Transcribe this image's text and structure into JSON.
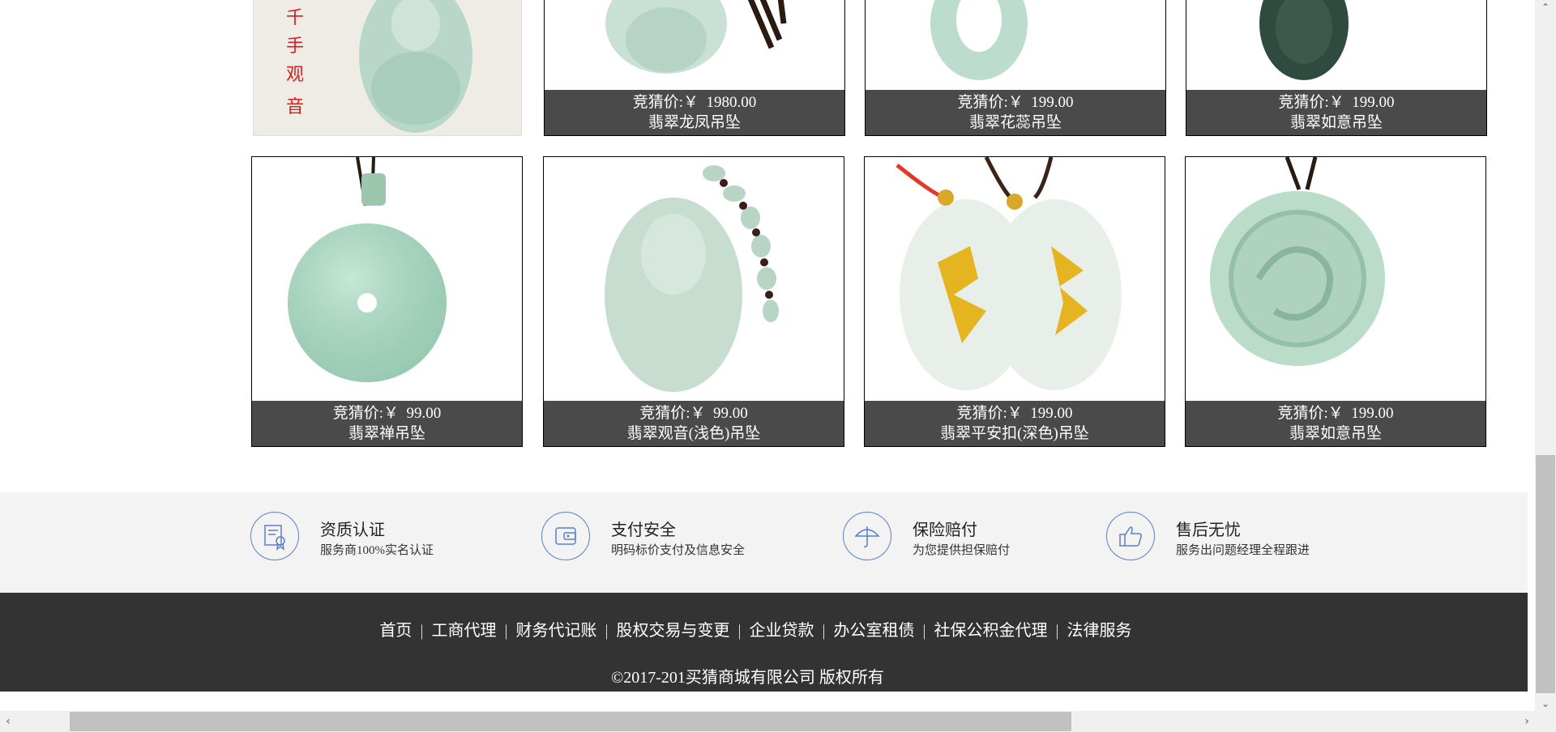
{
  "products": [
    {
      "price_label": "竞猜价:",
      "currency": "￥",
      "price": "1980.00",
      "name": "翡翠龙凤吊坠"
    },
    {
      "price_label": "竞猜价:",
      "currency": "￥",
      "price": "199.00",
      "name": "翡翠花蕊吊坠"
    },
    {
      "price_label": "竞猜价:",
      "currency": "￥",
      "price": "199.00",
      "name": "翡翠如意吊坠"
    },
    {
      "price_label": "竞猜价:",
      "currency": "￥",
      "price": "99.00",
      "name": "翡翠禅吊坠"
    },
    {
      "price_label": "竞猜价:",
      "currency": "￥",
      "price": "99.00",
      "name": "翡翠观音(浅色)吊坠"
    },
    {
      "price_label": "竞猜价:",
      "currency": "￥",
      "price": "199.00",
      "name": "翡翠平安扣(深色)吊坠"
    },
    {
      "price_label": "竞猜价:",
      "currency": "￥",
      "price": "199.00",
      "name": "翡翠如意吊坠"
    }
  ],
  "services": [
    {
      "title": "资质认证",
      "desc": "服务商100%实名认证",
      "icon": "certificate-icon"
    },
    {
      "title": "支付安全",
      "desc": "明码标价支付及信息安全",
      "icon": "wallet-icon"
    },
    {
      "title": "保险赔付",
      "desc": "为您提供担保赔付",
      "icon": "umbrella-icon"
    },
    {
      "title": "售后无忧",
      "desc": "服务出问题经理全程跟进",
      "icon": "thumbs-up-icon"
    }
  ],
  "footer": {
    "links": [
      "首页",
      "工商代理",
      "财务代记账",
      "股权交易与变更",
      "企业贷款",
      "办公室租债",
      "社保公积金代理",
      "法律服务"
    ],
    "separator": "|",
    "copyright": "©2017-201买猜商城有限公司  版权所有"
  },
  "colors": {
    "caption_bg": "#4a4a4a",
    "service_bg": "#f3f3f3",
    "footer_bg": "#333333",
    "icon_stroke": "#5a7fc8"
  }
}
